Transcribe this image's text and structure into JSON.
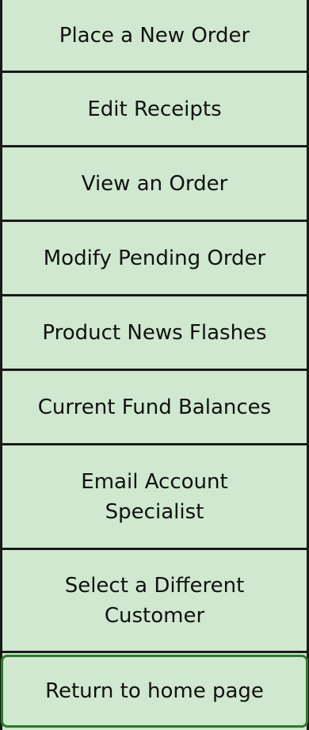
{
  "menu": {
    "items": [
      {
        "label": "Place a New Order"
      },
      {
        "label": "Edit Receipts"
      },
      {
        "label": "View an Order"
      },
      {
        "label": "Modify Pending Order"
      },
      {
        "label": "Product News Flashes"
      },
      {
        "label": "Current Fund Balances"
      },
      {
        "label": "Email Account Specialist"
      },
      {
        "label": "Select a Different Customer"
      },
      {
        "label": "Return to home page"
      }
    ]
  }
}
